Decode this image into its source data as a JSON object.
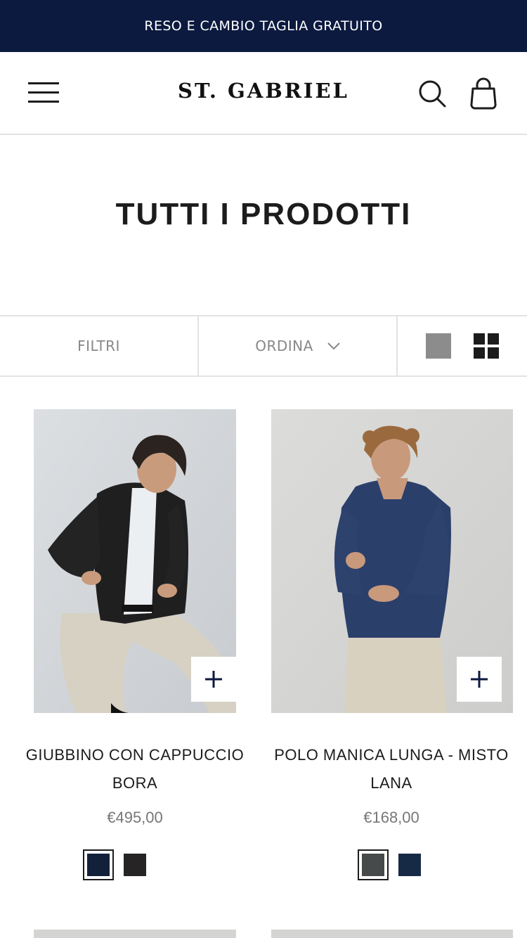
{
  "announcement": {
    "text": "RESO E CAMBIO TAGLIA GRATUITO"
  },
  "header": {
    "logo": "ST. GABRIEL",
    "icons": [
      "menu-icon",
      "search-icon",
      "cart-icon"
    ]
  },
  "page_title": "TUTTI I PRODOTTI",
  "toolbar": {
    "filter_label": "FILTRI",
    "sort_label": "ORDINA",
    "view_options": [
      "single-column-view-icon",
      "grid-view-icon"
    ]
  },
  "colors": {
    "brand_navy": "#0c1a40",
    "price_gray": "#777777",
    "border": "#e3e3e3"
  },
  "products": [
    {
      "name": "GIUBBINO CON CAPPUCCIO BORA",
      "price": "€495,00",
      "swatches": [
        {
          "color": "#13203a",
          "selected": true
        },
        {
          "color": "#262424",
          "selected": false
        }
      ]
    },
    {
      "name": "POLO MANICA LUNGA - MISTO LANA",
      "price": "€168,00",
      "swatches": [
        {
          "color": "#474a4b",
          "selected": true
        },
        {
          "color": "#172a45",
          "selected": false
        }
      ]
    }
  ]
}
